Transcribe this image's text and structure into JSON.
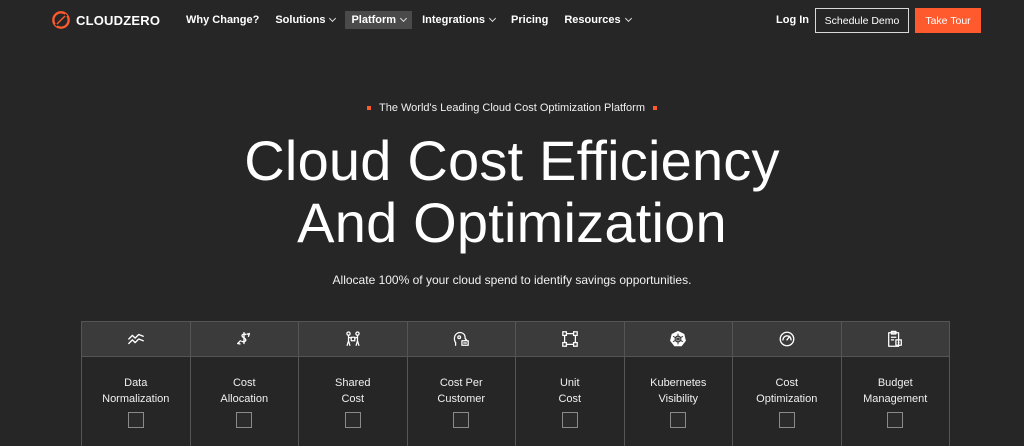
{
  "brand": {
    "name": "CLOUDZERO",
    "accent": "#ff5a2e",
    "logo_icon": "cloudzero-logo-icon"
  },
  "nav": {
    "items": [
      {
        "label": "Why Change?",
        "dropdown": false
      },
      {
        "label": "Solutions",
        "dropdown": true
      },
      {
        "label": "Platform",
        "dropdown": true,
        "active": true
      },
      {
        "label": "Integrations",
        "dropdown": true
      },
      {
        "label": "Pricing",
        "dropdown": false
      },
      {
        "label": "Resources",
        "dropdown": true
      }
    ],
    "login": "Log In",
    "schedule_demo": "Schedule Demo",
    "take_tour": "Take Tour"
  },
  "hero": {
    "eyebrow": "The World's Leading Cloud Cost Optimization Platform",
    "headline_line1": "Cloud Cost Efficiency",
    "headline_line2": "And Optimization",
    "subtext": "Allocate 100% of your cloud spend to identify savings opportunities."
  },
  "features": [
    {
      "line1": "Data",
      "line2": "Normalization",
      "icon": "trend-lines-icon"
    },
    {
      "line1": "Cost",
      "line2": "Allocation",
      "icon": "dollar-arrows-icon"
    },
    {
      "line1": "Shared",
      "line2": "Cost",
      "icon": "people-sharing-icon"
    },
    {
      "line1": "Cost Per",
      "line2": "Customer",
      "icon": "customer-head-icon"
    },
    {
      "line1": "Unit",
      "line2": "Cost",
      "icon": "unit-nodes-icon"
    },
    {
      "line1": "Kubernetes",
      "line2": "Visibility",
      "icon": "kubernetes-icon"
    },
    {
      "line1": "Cost",
      "line2": "Optimization",
      "icon": "gauge-icon"
    },
    {
      "line1": "Budget",
      "line2": "Management",
      "icon": "clipboard-icon"
    }
  ]
}
